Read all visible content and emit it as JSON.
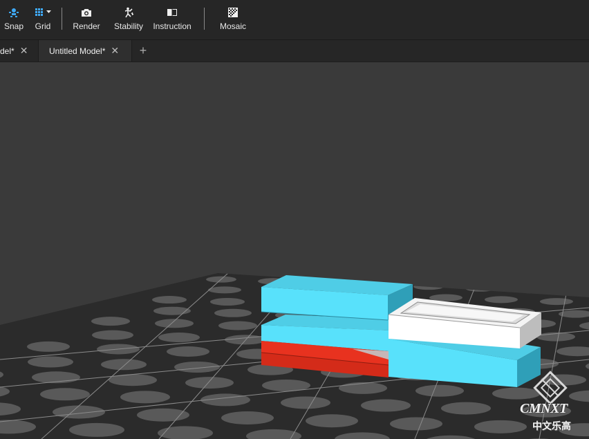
{
  "toolbar": {
    "snap_label": "Snap",
    "grid_label": "Grid",
    "render_label": "Render",
    "stability_label": "Stability",
    "instruction_label": "Instruction",
    "mosaic_label": "Mosaic",
    "icons": {
      "snap": "snap-magnet-icon",
      "grid": "grid-icon",
      "render": "camera-icon",
      "stability": "stability-figure-icon",
      "instruction": "book-icon",
      "mosaic": "mosaic-icon"
    },
    "accent_color": "#3fa9f5"
  },
  "tabs": [
    {
      "label": "Untitled Model*",
      "visible_label": "del*",
      "active": false
    },
    {
      "label": "Untitled Model*",
      "visible_label": "Untitled Model*",
      "active": true
    }
  ],
  "add_tab_label": "+",
  "viewport": {
    "background": "#3a3a3a",
    "baseplate_color": "#2b2b2b",
    "stud_color": "#595959",
    "bricks": [
      {
        "color": "cyan",
        "hex": "#58e1fb"
      },
      {
        "color": "red",
        "hex": "#e8321f"
      },
      {
        "color": "white",
        "hex": "#ffffff"
      }
    ]
  },
  "watermark": {
    "brand": "CMNXT",
    "subtitle": "中文乐高"
  }
}
